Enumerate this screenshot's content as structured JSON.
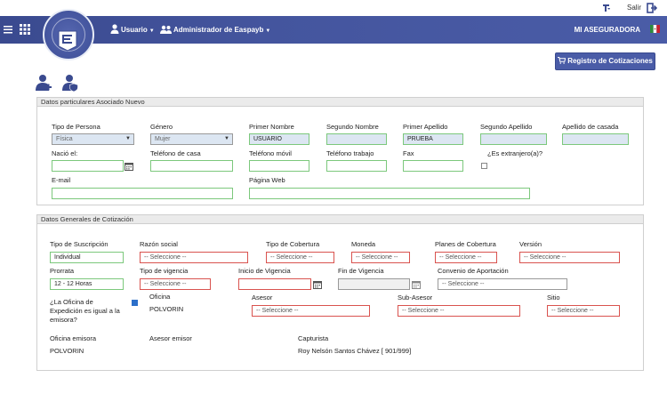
{
  "topbar": {
    "exit_label": "Salir"
  },
  "nav": {
    "user_menu": "Usuario",
    "admin_menu": "Administrador de Easpayb",
    "brand": "MI ASEGURADORA"
  },
  "actions": {
    "registro": "Registro de Cotizaciones"
  },
  "particulares": {
    "title": "Datos particulares Asociado Nuevo",
    "tipo_persona": {
      "label": "Tipo de Persona",
      "value": "Física"
    },
    "genero": {
      "label": "Género",
      "value": "Mujer"
    },
    "primer_nombre": {
      "label": "Primer Nombre",
      "value": "USUARIO"
    },
    "segundo_nombre": {
      "label": "Segundo Nombre",
      "value": ""
    },
    "primer_apellido": {
      "label": "Primer Apellido",
      "value": "PRUEBA"
    },
    "segundo_apellido": {
      "label": "Segundo Apellido",
      "value": ""
    },
    "apellido_casada": {
      "label": "Apellido de casada",
      "value": ""
    },
    "nacio": {
      "label": "Nació el:",
      "value": ""
    },
    "tel_casa": {
      "label": "Teléfono de casa",
      "value": ""
    },
    "tel_movil": {
      "label": "Teléfono móvil",
      "value": ""
    },
    "tel_trabajo": {
      "label": "Teléfono trabajo",
      "value": ""
    },
    "fax": {
      "label": "Fax",
      "value": ""
    },
    "extranjero": {
      "label": "¿Es extranjero(a)?",
      "checked": false
    },
    "email": {
      "label": "E-mail",
      "value": ""
    },
    "web": {
      "label": "Página Web",
      "value": ""
    }
  },
  "cotizacion": {
    "title": "Datos Generales de Cotización",
    "suscripcion": {
      "label": "Tipo de Suscripción",
      "value": "Individual"
    },
    "razon_social": {
      "label": "Razón social",
      "value": "-- Seleccione --"
    },
    "cobertura_tipo": {
      "label": "Tipo de Cobertura",
      "value": "-- Seleccione --"
    },
    "moneda": {
      "label": "Moneda",
      "value": "-- Seleccione --"
    },
    "planes": {
      "label": "Planes de Cobertura",
      "value": "-- Seleccione --"
    },
    "version": {
      "label": "Versión",
      "value": "-- Seleccione --"
    },
    "prorrata": {
      "label": "Prorrata",
      "value": "12 - 12 Horas"
    },
    "tipo_vigencia": {
      "label": "Tipo de vigencia",
      "value": "-- Seleccione --"
    },
    "inicio_vigencia": {
      "label": "Inicio de Vigencia",
      "value": ""
    },
    "fin_vigencia": {
      "label": "Fin de Vigencia",
      "value": ""
    },
    "convenio": {
      "label": "Convenio de Aportación",
      "value": "-- Seleccione --"
    },
    "oficina_igual": {
      "label": "¿La Oficina de Expedición es igual a la emisora?",
      "checked": true
    },
    "oficina": {
      "label": "Oficina",
      "value": "POLVORIN"
    },
    "asesor": {
      "label": "Asesor",
      "value": "-- Seleccione --"
    },
    "sub_asesor": {
      "label": "Sub-Asesor",
      "value": "-- Seleccione --"
    },
    "sitio": {
      "label": "Sitio",
      "value": "-- Seleccione --"
    },
    "oficina_emisora": {
      "label": "Oficina emisora",
      "value": "POLVORIN"
    },
    "asesor_emisor": {
      "label": "Asesor emisor",
      "value": ""
    },
    "capturista": {
      "label": "Capturista",
      "value": "Roy Nelsón Santos Chávez [ 901/999]"
    }
  },
  "colors": {
    "nav": "#44559e",
    "valid": "#7cc87c",
    "required": "#d9534f",
    "filled": "#dce6f2"
  },
  "icons": [
    "flag-icon",
    "exit-icon",
    "menu-icon",
    "apps-grid-icon",
    "user-icon",
    "users-icon",
    "cart-icon",
    "add-user-icon",
    "user-shield-icon",
    "calendar-icon"
  ]
}
